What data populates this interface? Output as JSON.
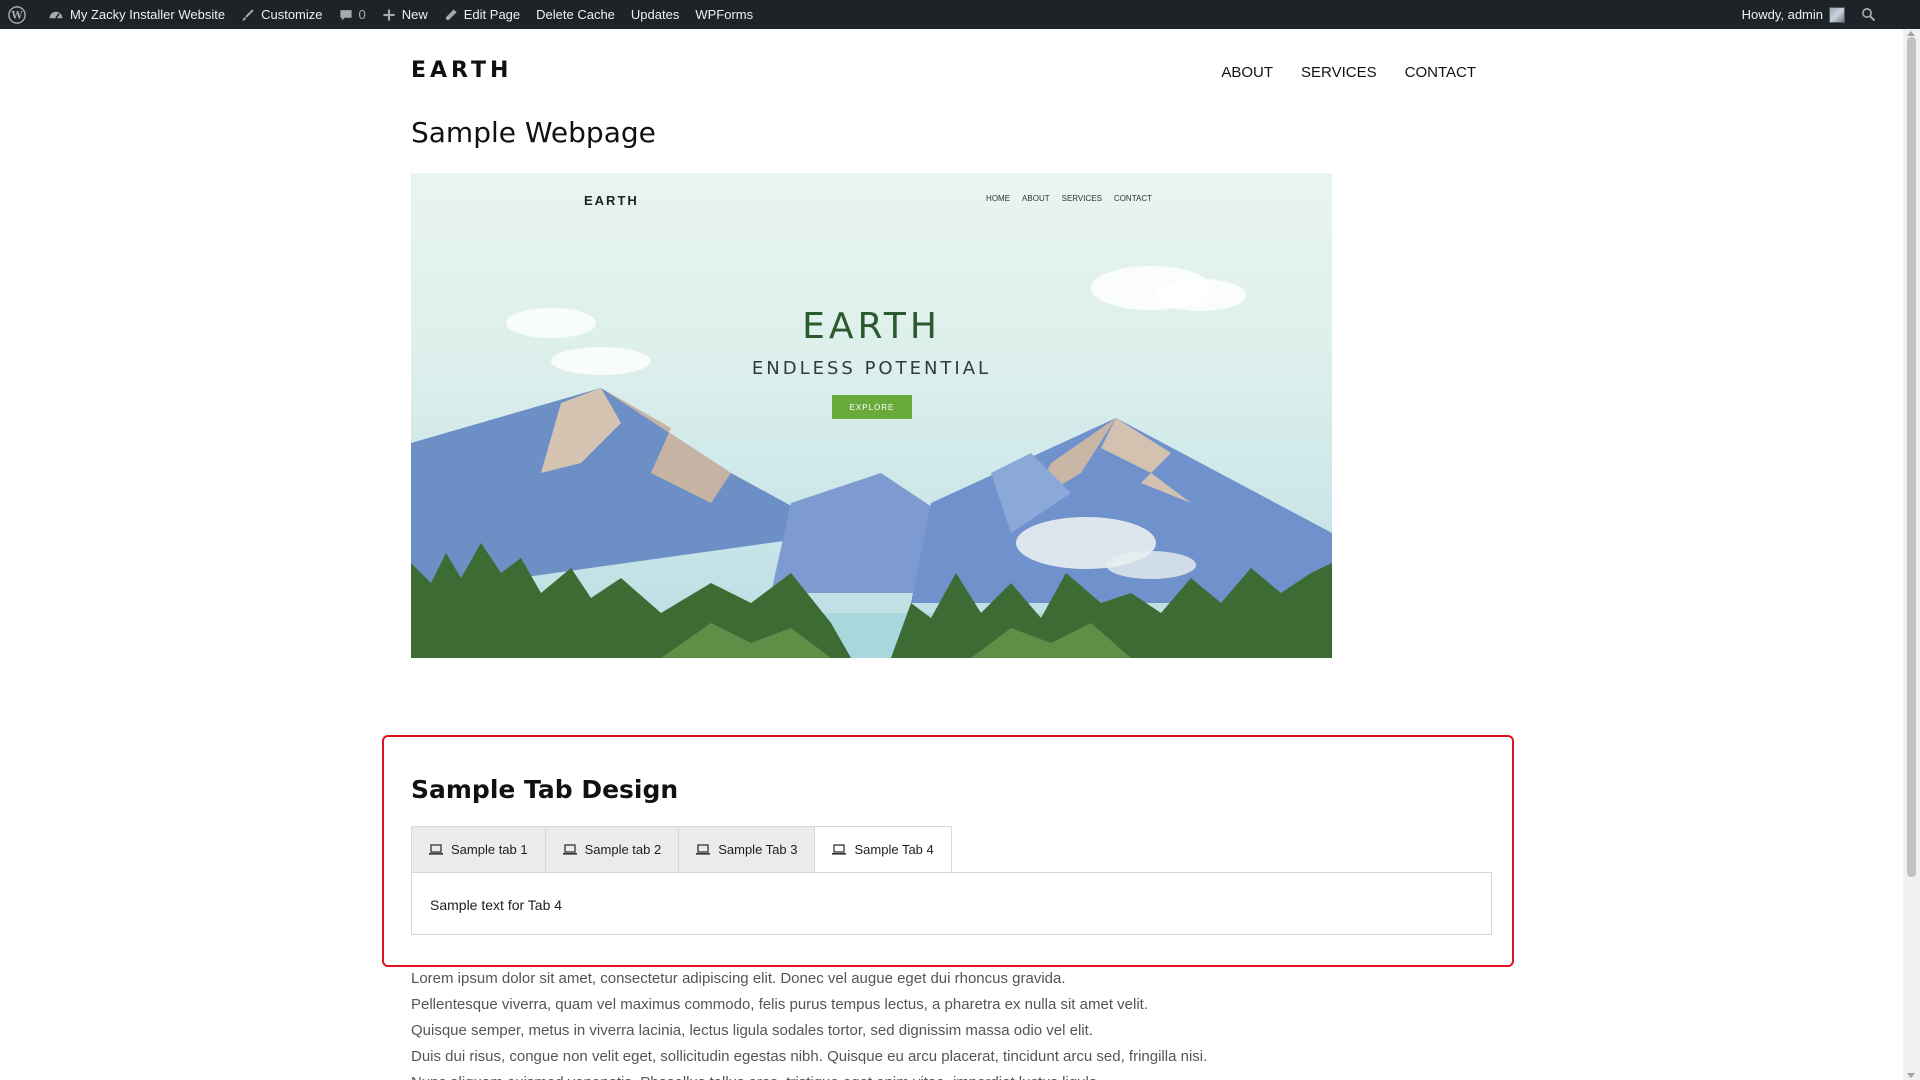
{
  "admin_bar": {
    "site_name": "My Zacky Installer Website",
    "customize": "Customize",
    "comments_count": "0",
    "new": "New",
    "edit_page": "Edit Page",
    "delete_cache": "Delete Cache",
    "updates": "Updates",
    "wpforms": "WPForms",
    "howdy": "Howdy, admin"
  },
  "site": {
    "logo": "EARTH",
    "nav": [
      "ABOUT",
      "SERVICES",
      "CONTACT"
    ]
  },
  "page_title": "Sample Webpage",
  "hero": {
    "logo": "EARTH",
    "nav": [
      "HOME",
      "ABOUT",
      "SERVICES",
      "CONTACT"
    ],
    "title": "EARTH",
    "subtitle": "ENDLESS POTENTIAL",
    "button": "EXPLORE"
  },
  "tab_section": {
    "heading": "Sample Tab Design",
    "tabs": [
      {
        "label": "Sample tab 1",
        "icon": "laptop-icon"
      },
      {
        "label": "Sample tab 2",
        "icon": "laptop-icon"
      },
      {
        "label": "Sample Tab 3",
        "icon": "laptop-icon"
      },
      {
        "label": "Sample Tab 4",
        "icon": "laptop-icon"
      }
    ],
    "active_tab": 3,
    "panel_text": "Sample text for Tab 4"
  },
  "lorem": [
    "Lorem ipsum dolor sit amet, consectetur adipiscing elit. Donec vel augue eget dui rhoncus gravida.",
    "Pellentesque viverra, quam vel maximus commodo, felis purus tempus lectus, a pharetra ex nulla sit amet velit.",
    "Quisque semper, metus in viverra lacinia, lectus ligula sodales tortor, sed dignissim massa odio vel elit.",
    "Duis dui risus, congue non velit eget, sollicitudin egestas nibh. Quisque eu arcu placerat, tincidunt arcu sed, fringilla nisi.",
    "Nunc aliquam euismod venenatis. Phasellus tellus eros, tristique eget enim vitae, imperdiet luctus ligula."
  ],
  "colors": {
    "admin_bar_bg": "#1d2327",
    "highlight_border": "#e0141e",
    "hero_button": "#6aaa3c",
    "hero_title": "#2b5a2e"
  }
}
